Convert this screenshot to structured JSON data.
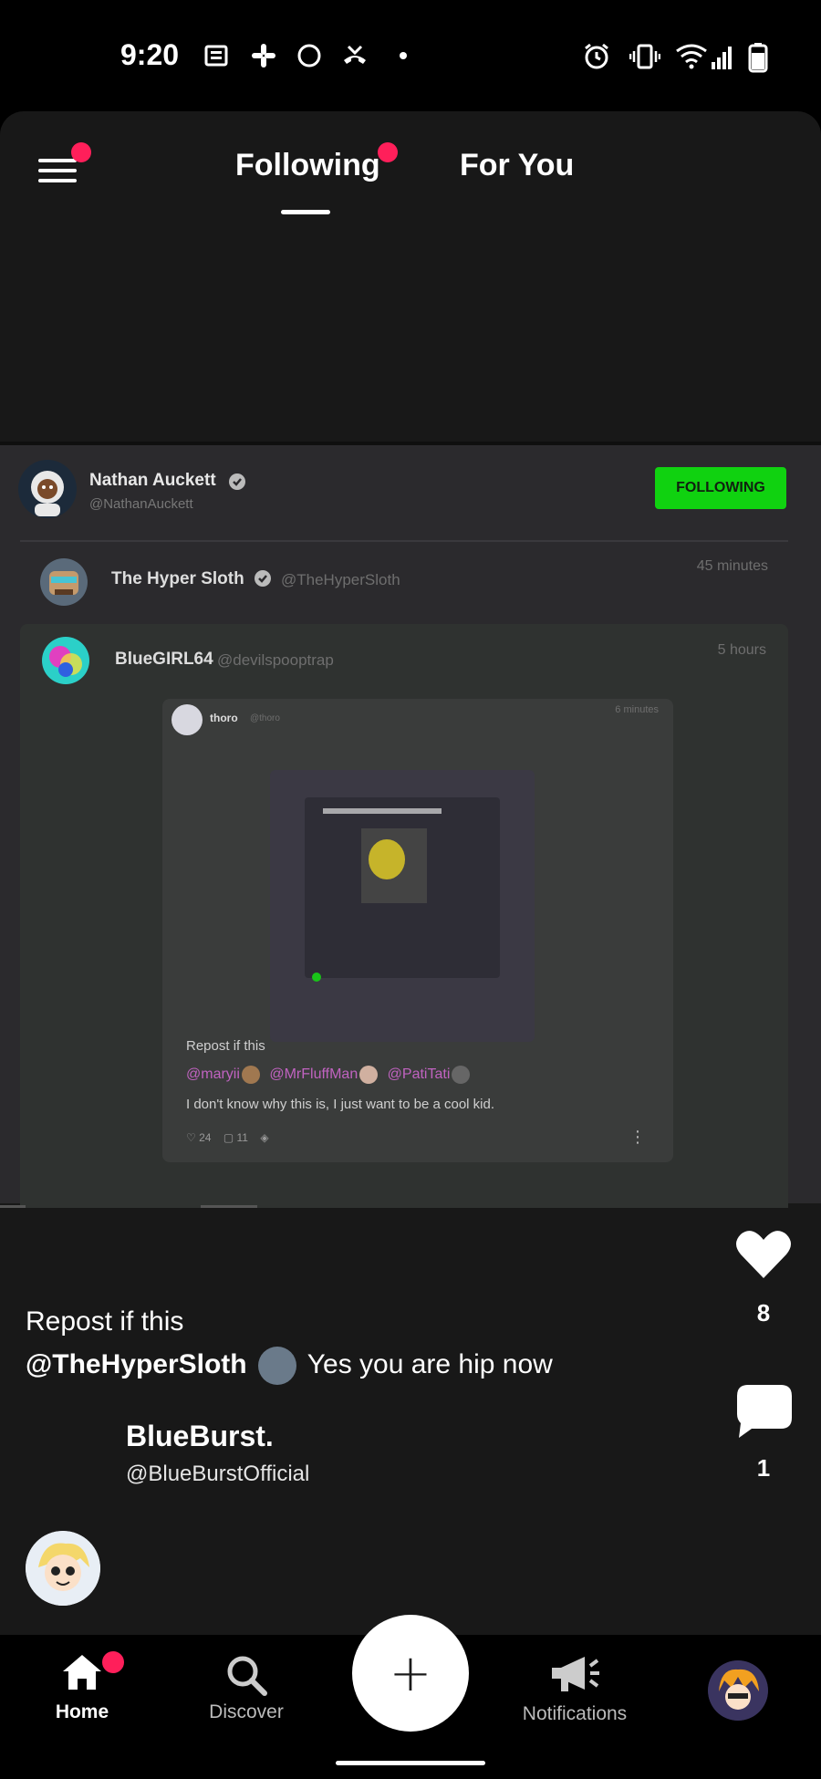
{
  "status_bar": {
    "time": "9:20"
  },
  "header": {
    "tabs": [
      {
        "label": "Following",
        "active": true,
        "has_notification_dot": true
      },
      {
        "label": "For You",
        "active": false
      }
    ],
    "menu_has_notification_dot": true
  },
  "embedded_screenshot": {
    "author": {
      "name": "Nathan Auckett",
      "handle": "@NathanAuckett",
      "follow_label": "FOLLOWING"
    },
    "post_1": {
      "name": "The Hyper Sloth",
      "handle": "@TheHyperSloth",
      "time": "45 minutes"
    },
    "post_2": {
      "name": "BlueGIRL64",
      "handle": "@devilspooptrap",
      "time": "5 hours",
      "quoted": {
        "name": "thoro",
        "handle": "@thoro",
        "time": "6 minutes",
        "text": "Repost if this",
        "mentions": [
          "@maryii",
          "@MrFluffMan",
          "@PatiTati"
        ],
        "body": "I don't know why this is, I just want to be a cool kid.",
        "likes": "24",
        "comments": "11"
      }
    }
  },
  "post": {
    "caption_line1": "Repost if this",
    "caption_mention": "@TheHyperSloth",
    "caption_rest": "Yes you are hip now",
    "poster_name": "BlueBurst.",
    "poster_handle": "@BlueBurstOfficial",
    "likes": "8",
    "comments": "1"
  },
  "bottom_nav": {
    "items": [
      {
        "label": "Home",
        "icon": "home-icon",
        "active": true,
        "has_notification_dot": true
      },
      {
        "label": "Discover",
        "icon": "search-icon",
        "active": false
      },
      {
        "label": "+",
        "icon": "plus-icon"
      },
      {
        "label": "Notifications",
        "icon": "megaphone-icon",
        "active": false
      },
      {
        "label": "",
        "icon": "profile-avatar"
      }
    ]
  },
  "colors": {
    "accent_dot": "#ff1f5a",
    "following_button": "#10d210",
    "mention_purple": "#c063c0"
  }
}
